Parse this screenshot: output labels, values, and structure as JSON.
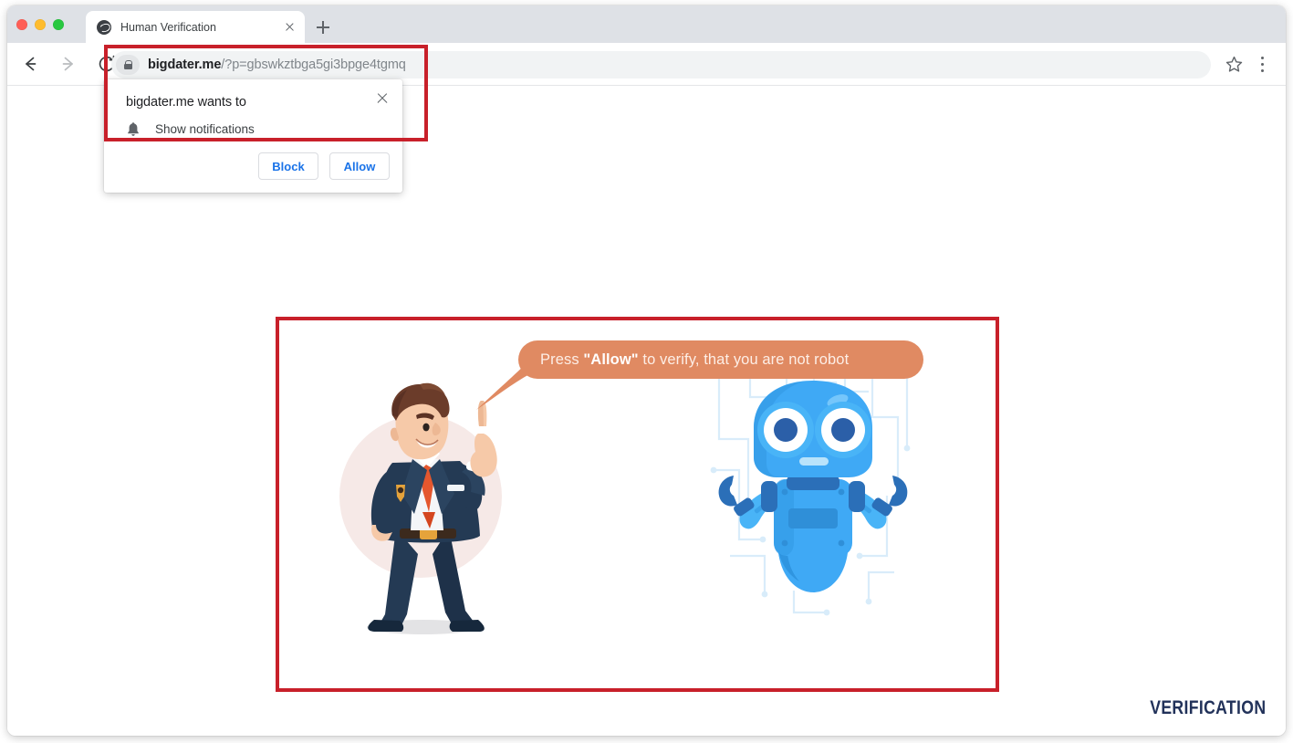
{
  "browser": {
    "tab": {
      "title": "Human Verification",
      "favicon": "globe-icon",
      "close": "close-icon"
    },
    "new_tab_label": "+",
    "toolbar": {
      "back": "back-arrow-icon",
      "forward": "forward-arrow-icon",
      "reload": "reload-icon",
      "lock": "lock-icon",
      "url_host": "bigdater.me",
      "url_path": "/?p=gbswkztbga5gi3bpge4tgmq",
      "bookmark": "star-icon",
      "menu": "three-dot-menu-icon"
    }
  },
  "permission_popup": {
    "title": "bigdater.me wants to",
    "permission_icon": "bell-icon",
    "permission_label": "Show notifications",
    "block_label": "Block",
    "allow_label": "Allow",
    "close_label": "×"
  },
  "page": {
    "bubble": {
      "prefix": "Press ",
      "emphasis": "\"Allow\"",
      "suffix": " to verify, that you are not robot"
    },
    "man_illustration": "businessman-pointing-up-illustration",
    "robot_illustration": "blue-robot-illustration",
    "watermark": "VERIFICATION"
  },
  "colors": {
    "highlight_red": "#c8202a",
    "bubble_orange": "#e08a62",
    "link_blue": "#1a73e8",
    "watermark_navy": "#22325a",
    "robot_blue": "#3fa9f5",
    "suit_navy": "#243a54",
    "tie_red": "#e4572e"
  }
}
